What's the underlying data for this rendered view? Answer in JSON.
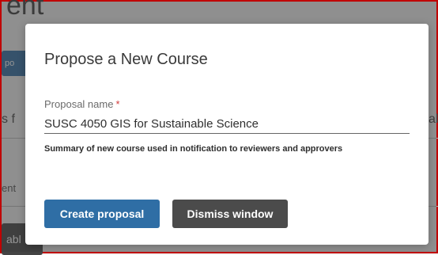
{
  "background": {
    "heading_fragment": "ent",
    "button_fragment": "po",
    "left_text_fragment": "s f",
    "right_text_fragment": "al",
    "left_text_fragment_2": "ent",
    "dark_button_fragment": "abl"
  },
  "modal": {
    "title": "Propose a New Course",
    "field": {
      "label": "Proposal name",
      "required_mark": "*",
      "value": "SUSC 4050 GIS for Sustainable Science",
      "help_text": "Summary of new course used in notification to reviewers and approvers"
    },
    "buttons": {
      "create": "Create proposal",
      "dismiss": "Dismiss window"
    }
  },
  "colors": {
    "primary": "#2f6ea5",
    "secondary": "#4b4b4b",
    "required": "#d13b3b"
  }
}
